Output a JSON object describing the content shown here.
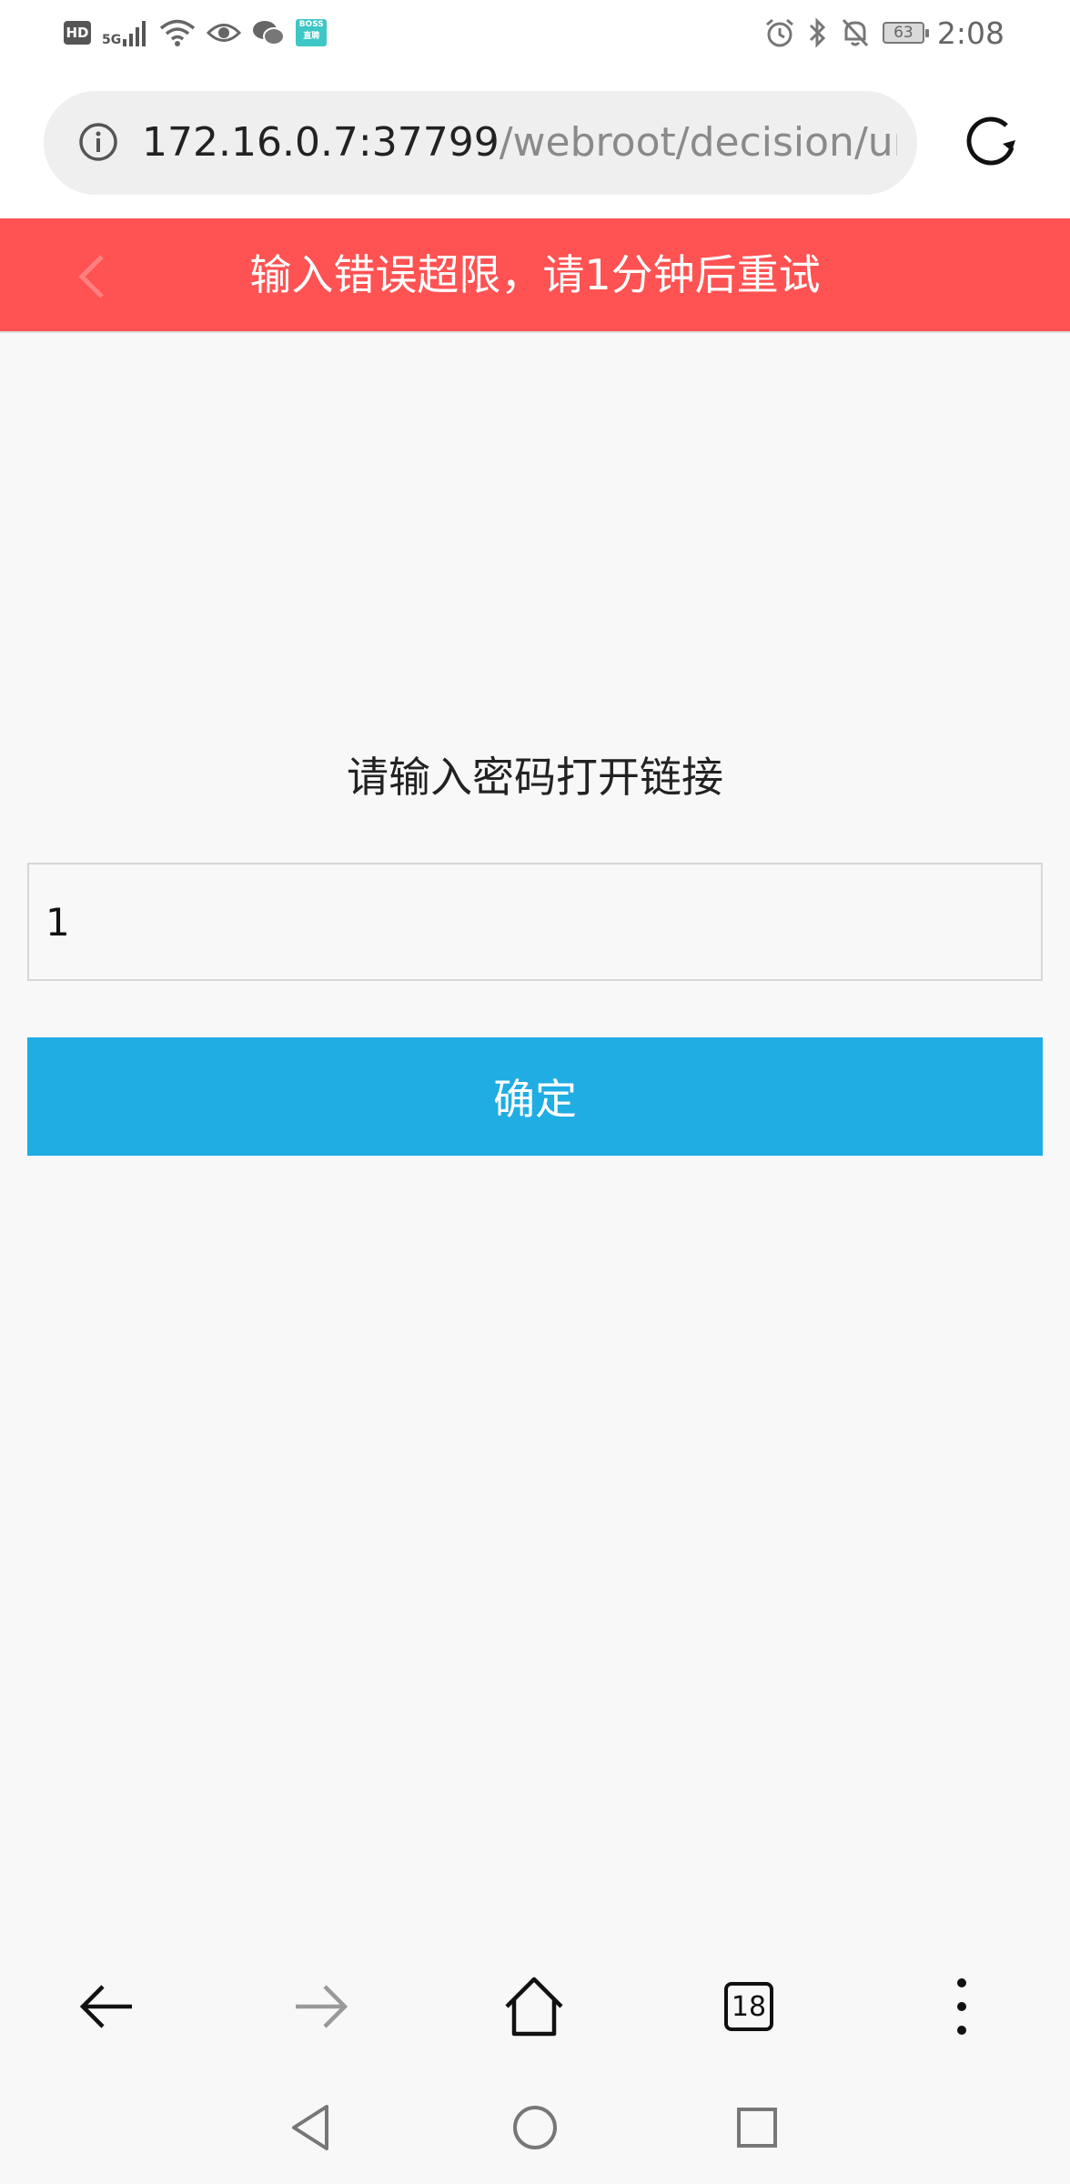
{
  "status_bar": {
    "hd_label": "HD",
    "network_label": "5G",
    "boss_app_label": "BOSS\n直聘",
    "battery_level": "63",
    "time": "2:08",
    "left_icons": [
      "hd-icon",
      "signal-icon",
      "wifi-icon",
      "eye-icon",
      "wechat-icon",
      "boss-app-icon"
    ],
    "right_icons": [
      "alarm-icon",
      "bluetooth-icon",
      "mute-bell-icon",
      "battery-icon"
    ]
  },
  "address_bar": {
    "url_host": "172.16.0.7:37799",
    "url_path": "/webroot/decision/ur",
    "info_icon": "info-icon",
    "reload_icon": "reload-icon"
  },
  "banner": {
    "message": "输入错误超限，请1分钟后重试",
    "background_color": "#ff5252",
    "back_icon": "chevron-left-icon"
  },
  "form": {
    "prompt": "请输入密码打开链接",
    "password_value": "1",
    "confirm_label": "确定",
    "button_color": "#1fade3"
  },
  "toolbar": {
    "back_icon": "arrow-left-icon",
    "forward_icon": "arrow-right-icon",
    "home_icon": "home-icon",
    "tab_count": "18",
    "menu_icon": "more-vertical-icon"
  },
  "system_nav": {
    "back_icon": "triangle-back-icon",
    "home_icon": "circle-home-icon",
    "recents_icon": "square-recents-icon"
  }
}
